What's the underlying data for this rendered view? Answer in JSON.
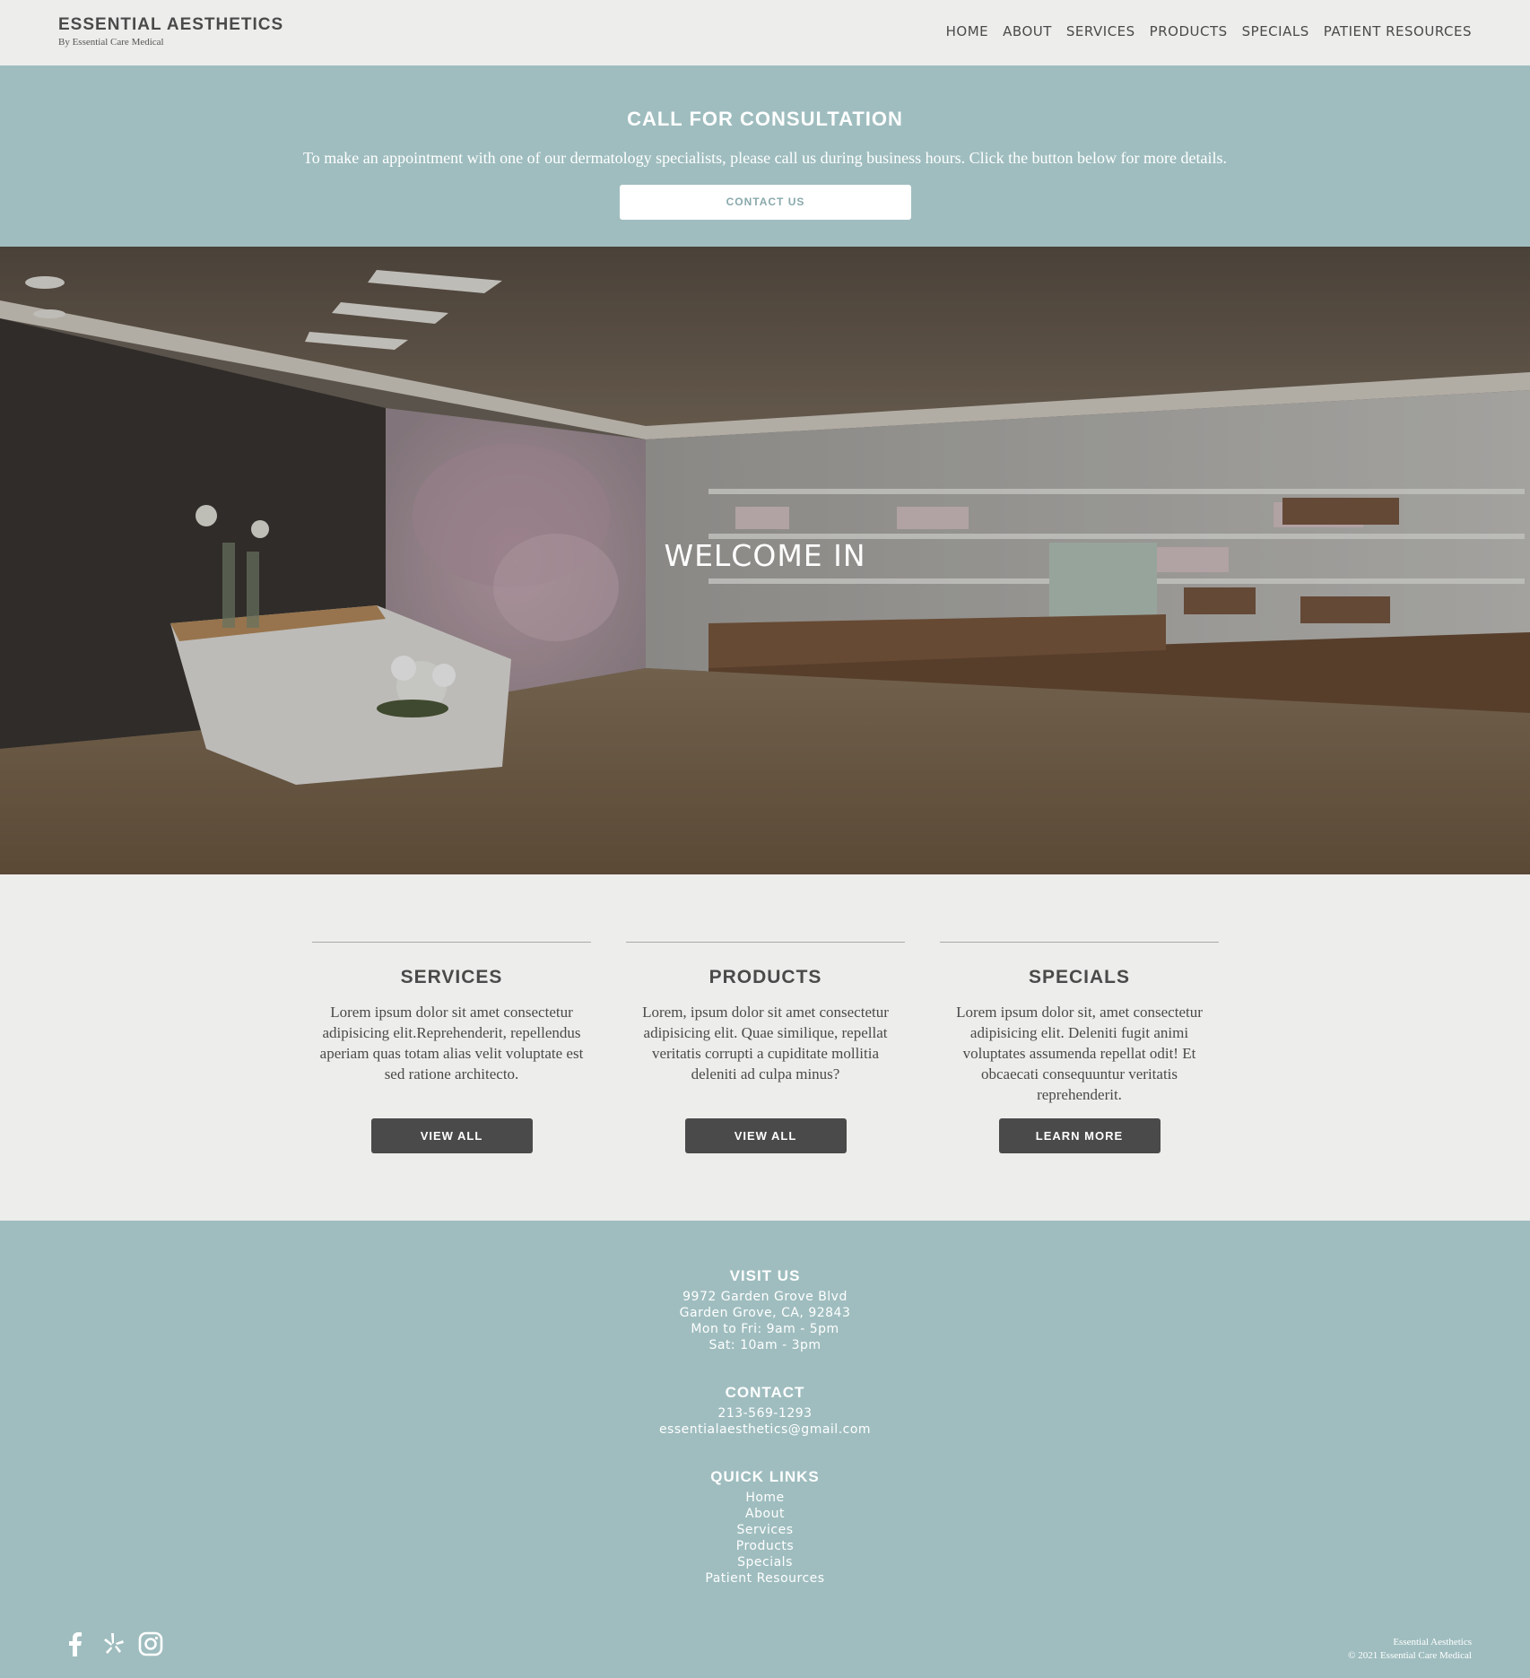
{
  "header": {
    "brand_title": "ESSENTIAL AESTHETICS",
    "brand_subtitle": "By Essential Care Medical",
    "nav": [
      "HOME",
      "ABOUT",
      "SERVICES",
      "PRODUCTS",
      "SPECIALS",
      "PATIENT RESOURCES"
    ]
  },
  "consultation": {
    "title": "CALL FOR CONSULTATION",
    "text": "To make an appointment with one of our dermatology specialists, please call us during business hours. Click the button below for more details.",
    "button": "CONTACT US"
  },
  "hero": {
    "title": "WELCOME IN"
  },
  "cards": [
    {
      "title": "SERVICES",
      "text": "Lorem ipsum dolor sit amet consectetur adipisicing elit.Reprehenderit, repellendus aperiam quas totam alias velit voluptate est sed ratione architecto.",
      "button": "VIEW ALL"
    },
    {
      "title": "PRODUCTS",
      "text": "Lorem, ipsum dolor sit amet consectetur adipisicing elit. Quae similique, repellat veritatis corrupti a cupiditate mollitia deleniti ad culpa minus?",
      "button": "VIEW ALL"
    },
    {
      "title": "SPECIALS",
      "text": "Lorem ipsum dolor sit, amet consectetur adipisicing elit. Deleniti fugit animi voluptates assumenda repellat odit! Et obcaecati consequuntur veritatis reprehenderit.",
      "button": "LEARN MORE"
    }
  ],
  "footer": {
    "visit": {
      "title": "VISIT US",
      "lines": [
        "9972 Garden Grove Blvd",
        "Garden Grove, CA, 92843",
        "Mon to Fri: 9am - 5pm",
        "Sat: 10am - 3pm"
      ]
    },
    "contact": {
      "title": "CONTACT",
      "phone": "213-569-1293",
      "email": "essentialaesthetics@gmail.com"
    },
    "quick_links": {
      "title": "QUICK LINKS",
      "links": [
        "Home",
        "About",
        "Services",
        "Products",
        "Specials",
        "Patient Resources"
      ]
    },
    "social_icons": [
      "facebook-icon",
      "yelp-icon",
      "instagram-icon"
    ],
    "copyright_name": "Essential Aesthetics",
    "copyright_line": "© 2021 Essential Care Medical"
  },
  "colors": {
    "accent": "#9fbdbf",
    "background": "#ededeb",
    "dark_button": "#4a4a4a"
  }
}
